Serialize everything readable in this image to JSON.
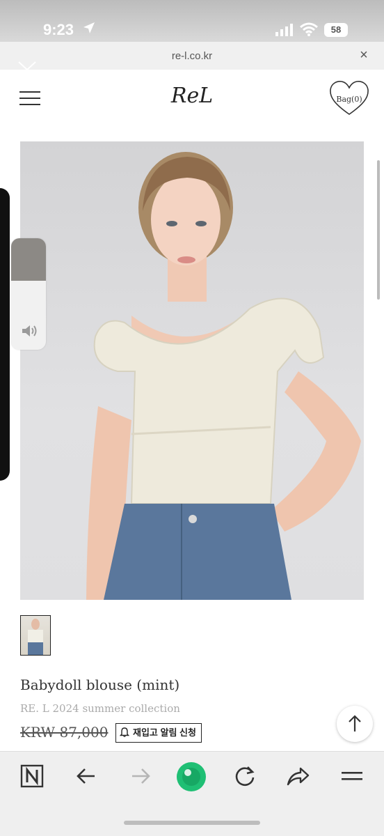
{
  "status_bar": {
    "time": "9:23",
    "battery": "58"
  },
  "browser": {
    "url": "re-l.co.kr",
    "close_symbol": "×"
  },
  "header": {
    "logo": "ReL",
    "bag_label": "Bag(0)"
  },
  "volume": {
    "level": 0.38
  },
  "product": {
    "name": "Babydoll blouse (mint)",
    "collection": "RE. L 2024 summer collection",
    "price": "KRW 87,000",
    "restock_label": "재입고 알림 신청"
  },
  "icons": {
    "menu": "hamburger-menu-icon",
    "bag": "heart-bag-icon",
    "scroll_top": "arrow-up-icon",
    "toolbar": [
      "naver-n-icon",
      "back-arrow-icon",
      "forward-arrow-icon",
      "green-dot-icon",
      "reload-icon",
      "share-icon",
      "menu-lines-icon"
    ]
  },
  "colors": {
    "accent_green": "#1fbf74",
    "text_dark": "#222222",
    "muted": "#aaaaaa"
  }
}
